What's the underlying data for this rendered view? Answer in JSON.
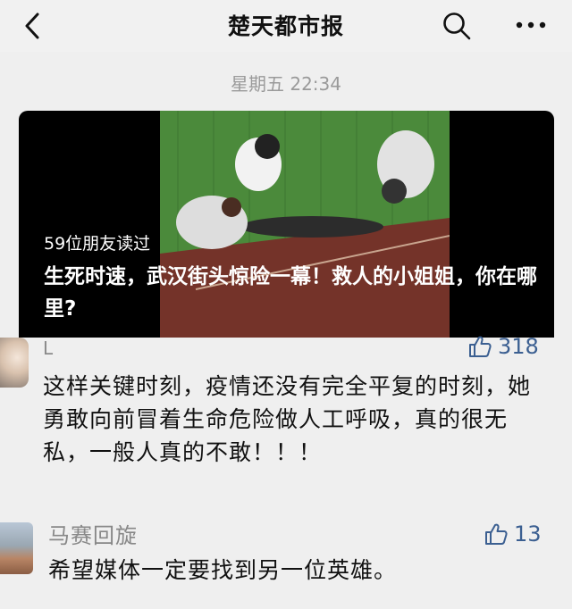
{
  "header": {
    "title": "楚天都市报",
    "icons": {
      "back": "chevron-left-icon",
      "search": "search-icon",
      "more": "more-dots-icon"
    }
  },
  "timestamp": "星期五 22:34",
  "article_card": {
    "readers": "59位朋友读过",
    "headline": "生死时速，武汉街头惊险一幕！救人的小姐姐，你在哪里?"
  },
  "comments": [
    {
      "name": "L",
      "likes": "318",
      "text": "这样关键时刻，疫情还没有完全平复的时刻，她勇敢向前冒着生命危险做人工呼吸，真的很无私，一般人真的不敢！！！"
    },
    {
      "name": "马赛回旋",
      "likes": "13",
      "text": "希望媒体一定要找到另一位英雄。"
    }
  ],
  "colors": {
    "like": "#3b5f91",
    "meta": "#9a9a9a",
    "background": "#efefef"
  }
}
